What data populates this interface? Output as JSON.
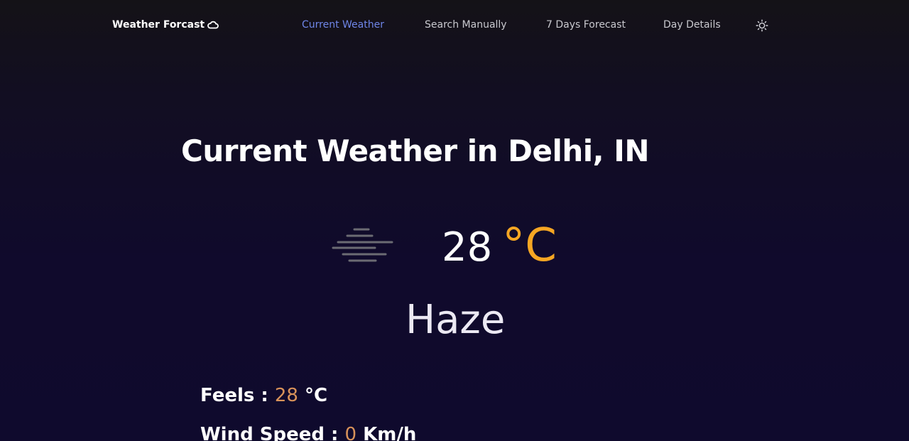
{
  "nav": {
    "brand": "Weather Forcast",
    "brand_icon": "cloud-icon",
    "links": [
      {
        "label": "Current Weather",
        "active": true
      },
      {
        "label": "Search Manually",
        "active": false
      },
      {
        "label": "7 Days Forecast",
        "active": false
      },
      {
        "label": "Day Details",
        "active": false
      }
    ],
    "theme_icon": "sun-icon"
  },
  "main": {
    "title": "Current Weather in Delhi, IN",
    "weather_icon": "haze-icon",
    "temperature": "28",
    "unit": "°C",
    "condition": "Haze",
    "feels": {
      "label": "Feels :",
      "value": "28",
      "unit": "°C"
    },
    "wind": {
      "label": "Wind Speed :",
      "value": "0",
      "unit": "Km/h"
    }
  },
  "colors": {
    "accent_active_link": "#6f86e8",
    "unit_orange": "#f5a623",
    "value_orange": "#d8925a"
  }
}
